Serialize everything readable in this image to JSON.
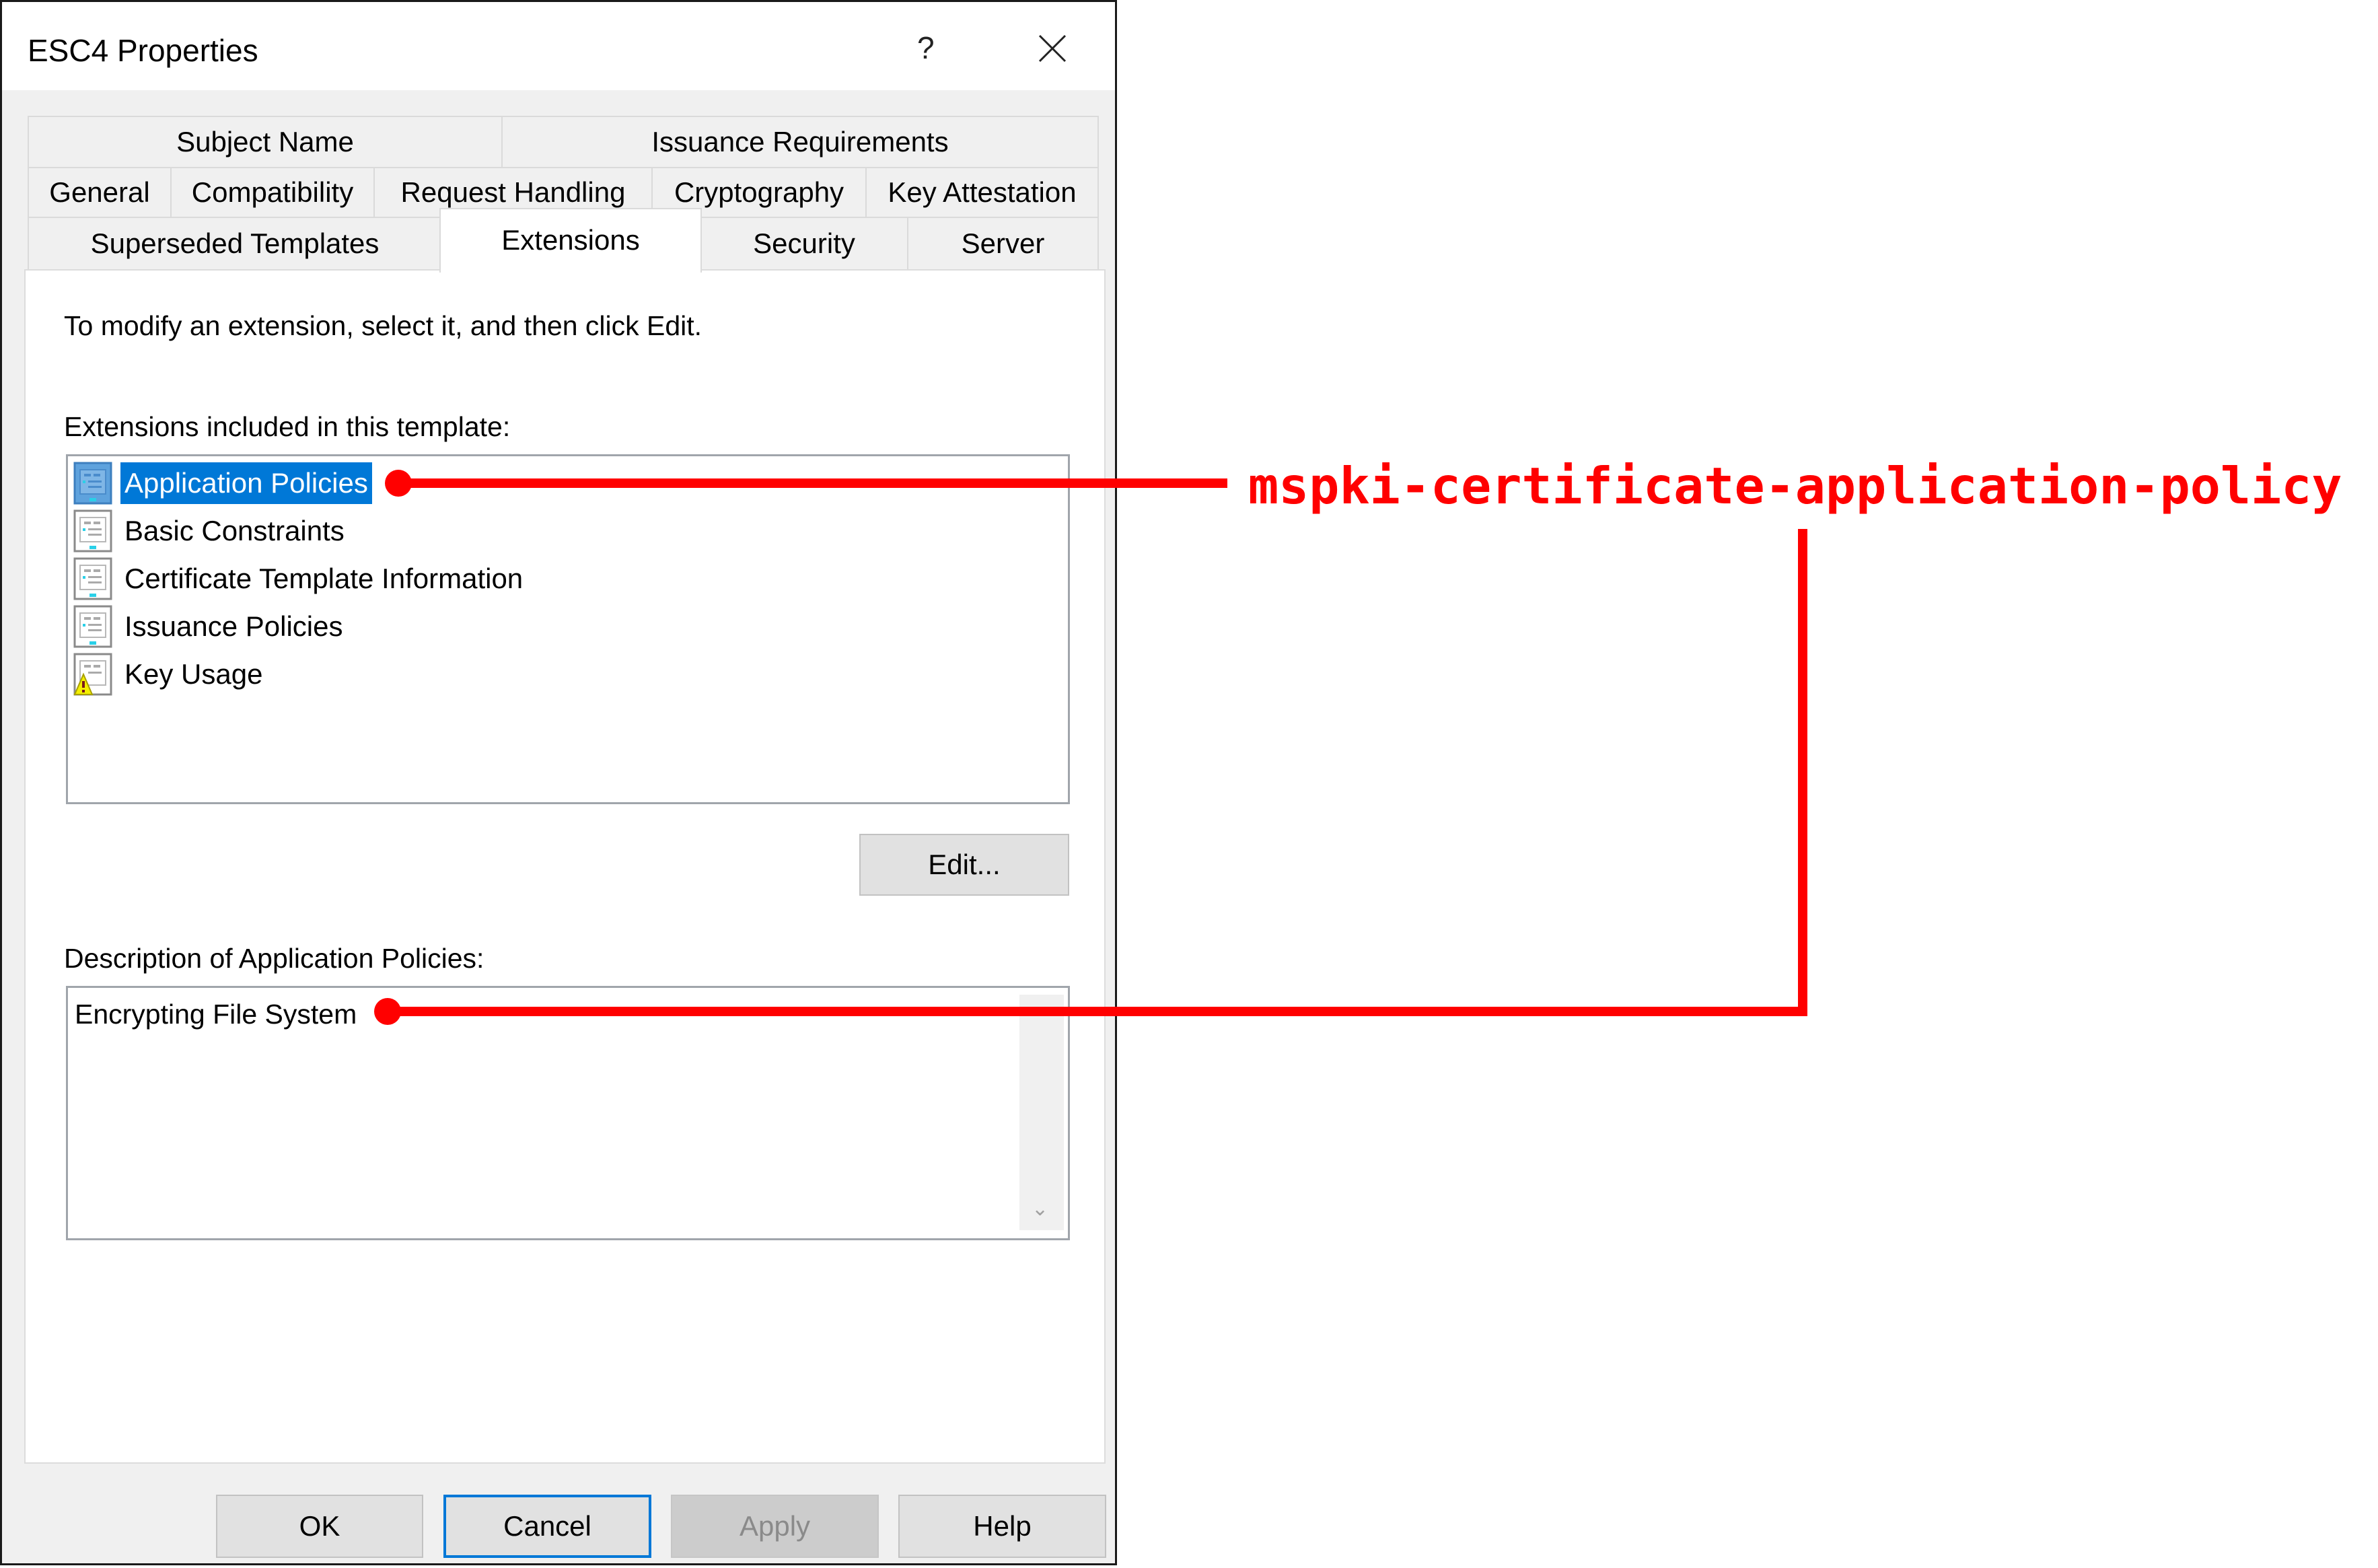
{
  "window": {
    "title": "ESC4 Properties",
    "help_glyph": "?",
    "close_icon": "close-icon"
  },
  "tabs": {
    "row1": [
      {
        "label": "Subject Name",
        "active": false
      },
      {
        "label": "Issuance Requirements",
        "active": false
      }
    ],
    "row2": [
      {
        "label": "General",
        "active": false
      },
      {
        "label": "Compatibility",
        "active": false
      },
      {
        "label": "Request Handling",
        "active": false
      },
      {
        "label": "Cryptography",
        "active": false
      },
      {
        "label": "Key Attestation",
        "active": false
      }
    ],
    "row3": [
      {
        "label": "Superseded Templates",
        "active": false
      },
      {
        "label": "Extensions",
        "active": true
      },
      {
        "label": "Security",
        "active": false
      },
      {
        "label": "Server",
        "active": false
      }
    ]
  },
  "extensions_tab": {
    "instruction": "To modify an extension, select it, and then click Edit.",
    "list_label": "Extensions included in this template:",
    "items": [
      {
        "label": "Application Policies",
        "icon": "extension-icon",
        "selected": true,
        "warning": false
      },
      {
        "label": "Basic Constraints",
        "icon": "extension-icon",
        "selected": false,
        "warning": false
      },
      {
        "label": "Certificate Template Information",
        "icon": "extension-icon",
        "selected": false,
        "warning": false
      },
      {
        "label": "Issuance Policies",
        "icon": "extension-icon",
        "selected": false,
        "warning": false
      },
      {
        "label": "Key Usage",
        "icon": "extension-warning-icon",
        "selected": false,
        "warning": true
      }
    ],
    "edit_button": "Edit...",
    "description_label": "Description of Application Policies:",
    "description_value": "Encrypting File System"
  },
  "footer": {
    "ok": "OK",
    "cancel": "Cancel",
    "apply": "Apply",
    "help": "Help"
  },
  "annotation": {
    "text": "mspki-certificate-application-policy",
    "color": "#ff0000"
  },
  "colors": {
    "selection": "#0078d7",
    "focus_border": "#0078d7",
    "annotation": "#ff0000"
  }
}
